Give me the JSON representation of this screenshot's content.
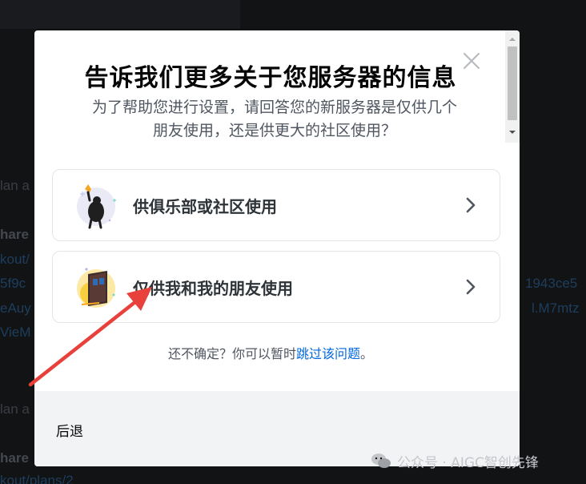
{
  "background": {
    "lines": [
      {
        "id": "plan-a-1",
        "text": "lan a"
      },
      {
        "id": "share-1",
        "text": "hare"
      },
      {
        "id": "kout-1",
        "text": "kout/"
      },
      {
        "id": "hash-left",
        "text": "5f9c"
      },
      {
        "id": "hash-right",
        "text": "1943ce5"
      },
      {
        "id": "eauy",
        "text": "eAuy"
      },
      {
        "id": "m7mtz",
        "text": "l.M7mtz"
      },
      {
        "id": "viem",
        "text": "VieM"
      },
      {
        "id": "plan-a-2",
        "text": "lan a"
      },
      {
        "id": "share-2",
        "text": "hare"
      },
      {
        "id": "kout-2",
        "text": "kout/plans/2"
      }
    ]
  },
  "modal": {
    "title": "告诉我们更多关于您服务器的信息",
    "subtitle_line1": "为了帮助您进行设置，请回答您的新服务器是仅供几个",
    "subtitle_line2": "朋友使用，还是供更大的社区使用？",
    "options": [
      {
        "label": "供俱乐部或社区使用",
        "icon": "club-community-icon"
      },
      {
        "label": "仅供我和我的朋友使用",
        "icon": "friends-door-icon"
      }
    ],
    "skip_prefix": "还不确定？你可以暂时",
    "skip_link": "跳过该问题",
    "skip_suffix": "。",
    "back_label": "后退"
  },
  "watermark": {
    "text": "公众号 · AIGC智创先锋",
    "icon": "wechat-icon"
  },
  "colors": {
    "annotation_arrow": "#e8403a",
    "link": "#0068e0",
    "footer_bg": "#f2f3f5"
  }
}
